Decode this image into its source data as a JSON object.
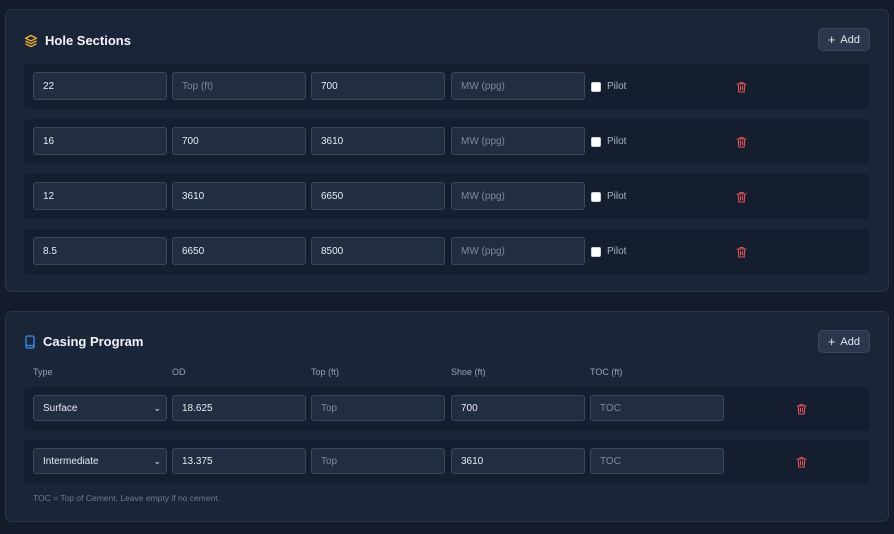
{
  "colors": {
    "accent_yellow": "#f2b52c",
    "accent_blue": "#3b8ff0",
    "danger": "#e0545a",
    "panel_bg": "#1b2538",
    "row_bg": "#151e2e"
  },
  "hole_sections": {
    "title": "Hole Sections",
    "icon": "layers-icon",
    "add_label": "Add",
    "rows": [
      {
        "size": "22",
        "top_placeholder": "Top (ft)",
        "bottom": "700",
        "mw_placeholder": "MW (ppg)",
        "pilot_label": "Pilot"
      },
      {
        "size": "16",
        "top": "700",
        "bottom": "3610",
        "mw_placeholder": "MW (ppg)",
        "pilot_label": "Pilot"
      },
      {
        "size": "12",
        "top": "3610",
        "bottom": "6650",
        "mw_placeholder": "MW (ppg)",
        "pilot_label": "Pilot"
      },
      {
        "size": "8.5",
        "top": "6650",
        "bottom": "8500",
        "mw_placeholder": "MW (ppg)",
        "pilot_label": "Pilot"
      }
    ]
  },
  "casing_program": {
    "title": "Casing Program",
    "icon": "casing-icon",
    "add_label": "Add",
    "columns": [
      "Type",
      "OD",
      "Top (ft)",
      "Shoe (ft)",
      "TOC (ft)"
    ],
    "rows": [
      {
        "type": "Surface",
        "od": "18.625",
        "top_placeholder": "Top",
        "shoe": "700",
        "toc_placeholder": "TOC"
      },
      {
        "type": "Intermediate",
        "od": "13.375",
        "top_placeholder": "Top",
        "shoe": "3610",
        "toc_placeholder": "TOC"
      }
    ],
    "footnote": "TOC = Top of Cement. Leave empty if no cement."
  }
}
